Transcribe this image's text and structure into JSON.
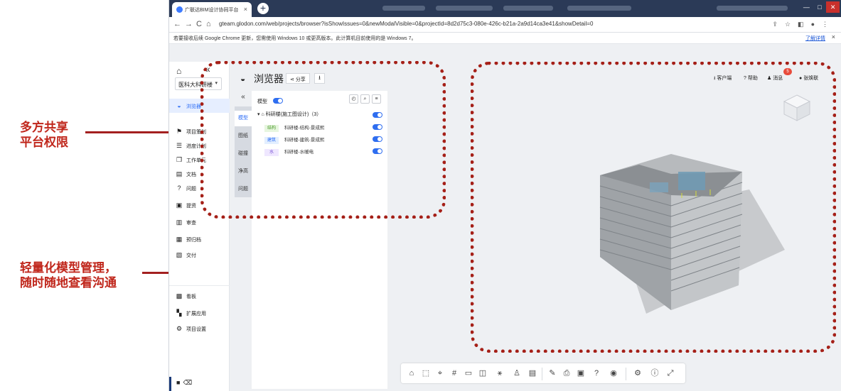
{
  "callouts": {
    "share": [
      "多方共享",
      "平台权限"
    ],
    "model": [
      "轻量化模型管理，",
      "随时随地查看沟通"
    ]
  },
  "browser": {
    "tab_title": "广联达BIM设计协同平台",
    "tab_close": "×",
    "new_tab": "+",
    "url": "gteam.glodon.com/web/projects/browser?isShowIssues=0&newModalVisible=0&projectId=8d2d75c3-080e-426c-b21a-2a9d14ca3e41&showDetail=0",
    "infobar_text": "若要接收后续 Google Chrome 更新，您需使用 Windows 10 或更高版本。此计算机目前使用的是 Windows 7。",
    "infobar_link": "了解详情",
    "infobar_close": "×",
    "nav_back": "←",
    "nav_forward": "→",
    "nav_reload": "C",
    "nav_home": "⌂"
  },
  "appnav": {
    "project": "医科大科研楼",
    "items": [
      {
        "icon": "globe-icon",
        "glyph": "◒",
        "label": "浏览器",
        "active": true
      },
      {
        "icon": "flag-icon",
        "glyph": "⚑",
        "label": "项目策划"
      },
      {
        "icon": "schedule-icon",
        "glyph": "☰",
        "label": "进度计划"
      },
      {
        "icon": "cube-icon",
        "glyph": "❒",
        "label": "工作单元"
      },
      {
        "icon": "document-icon",
        "glyph": "▤",
        "label": "文档"
      },
      {
        "icon": "question-icon",
        "glyph": "?",
        "label": "问题"
      },
      {
        "icon": "submit-icon",
        "glyph": "▣",
        "label": "提资"
      },
      {
        "icon": "review-icon",
        "glyph": "▥",
        "label": "审查"
      },
      {
        "icon": "archive-icon",
        "glyph": "▦",
        "label": "预归档"
      },
      {
        "icon": "deliver-icon",
        "glyph": "▧",
        "label": "交付"
      },
      {
        "icon": "kanban-icon",
        "glyph": "▩",
        "label": "看板"
      },
      {
        "icon": "apps-icon",
        "glyph": "▚",
        "label": "扩展应用"
      },
      {
        "icon": "gear-icon",
        "glyph": "⚙",
        "label": "项目设置"
      }
    ]
  },
  "viewer": {
    "title": "浏览器",
    "share_label": "分享",
    "header_right": {
      "client": "客户端",
      "help": "帮助",
      "messages": "消息",
      "message_count": "5",
      "user": "张焕联"
    }
  },
  "panel": {
    "tabs": [
      "模型",
      "图纸",
      "碰撞",
      "净高",
      "问题"
    ],
    "active_tab": "模型",
    "title": "模型",
    "root": "科研楼(施工图设计)（3）",
    "rows": [
      {
        "tag": "结构",
        "tag_color": "#e7f6df",
        "tag_text_color": "#4a9a2a",
        "name": "科研楼-结构-景成熙"
      },
      {
        "tag": "建筑",
        "tag_color": "#e3efff",
        "tag_text_color": "#2b6cf6",
        "name": "科研楼-建筑-景成熙"
      },
      {
        "tag": "水",
        "tag_color": "#efe7ff",
        "tag_text_color": "#7b55d6",
        "name": "科研楼-水暖电"
      }
    ]
  },
  "colors": {
    "accent": "#2b6cf6",
    "callout_red": "#c0271c",
    "dash_red": "#a52018"
  }
}
